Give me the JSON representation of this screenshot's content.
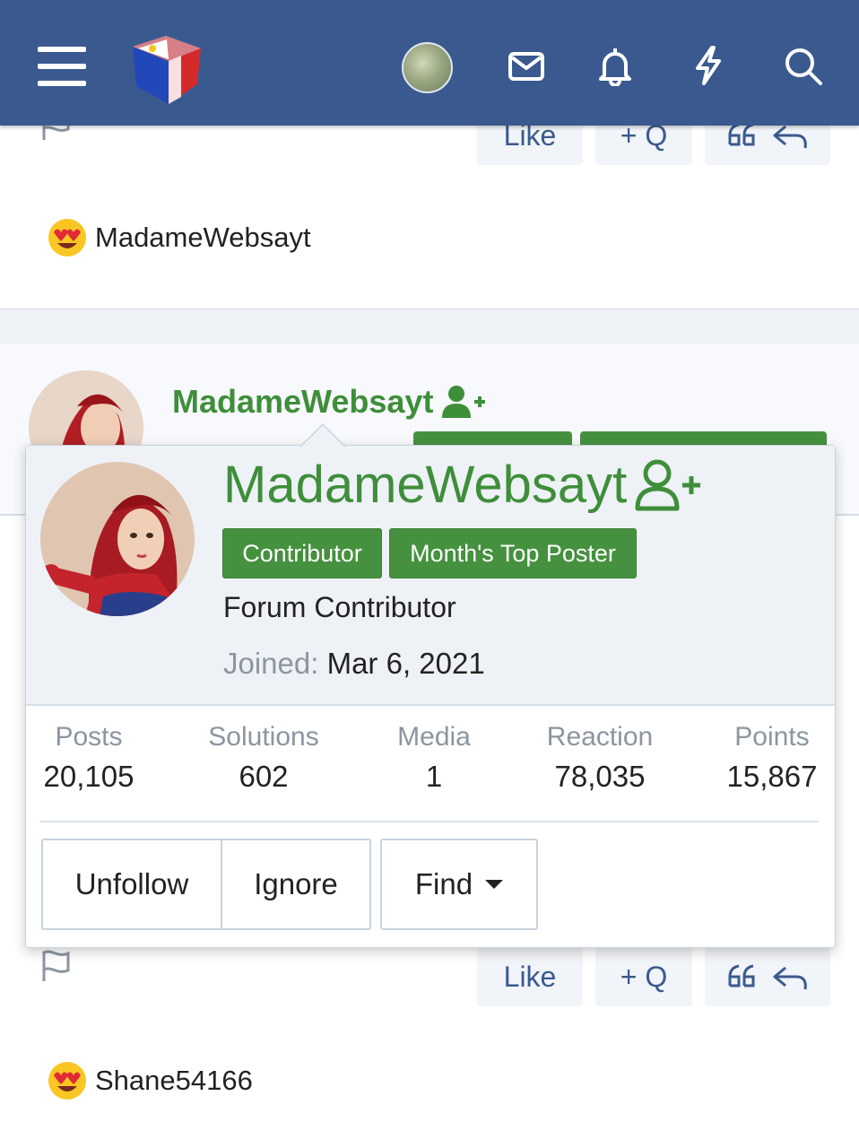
{
  "reactions": {
    "first_user": "MadameWebsayt",
    "second_user": "Shane54166"
  },
  "post_actions": {
    "like_label": "Like",
    "quick_quote_label": "+ Q"
  },
  "profile_card": {
    "username": "MadameWebsayt",
    "badges": [
      "Contributor",
      "Month's Top Poster"
    ],
    "user_title": "Forum Contributor",
    "joined_label": "Joined:",
    "joined_value": "Mar 6, 2021",
    "stats": [
      {
        "label": "Posts",
        "value": "20,105"
      },
      {
        "label": "Solutions",
        "value": "602"
      },
      {
        "label": "Media",
        "value": "1"
      },
      {
        "label": "Reaction",
        "value": "78,035"
      },
      {
        "label": "Points",
        "value": "15,867"
      }
    ],
    "buttons": {
      "unfollow": "Unfollow",
      "ignore": "Ignore",
      "find": "Find"
    }
  },
  "colors": {
    "header_bg": "#3a5a8f",
    "username_green": "#3f8e3a",
    "badge_green": "#45913f",
    "action_blue": "#3a5a8f"
  }
}
